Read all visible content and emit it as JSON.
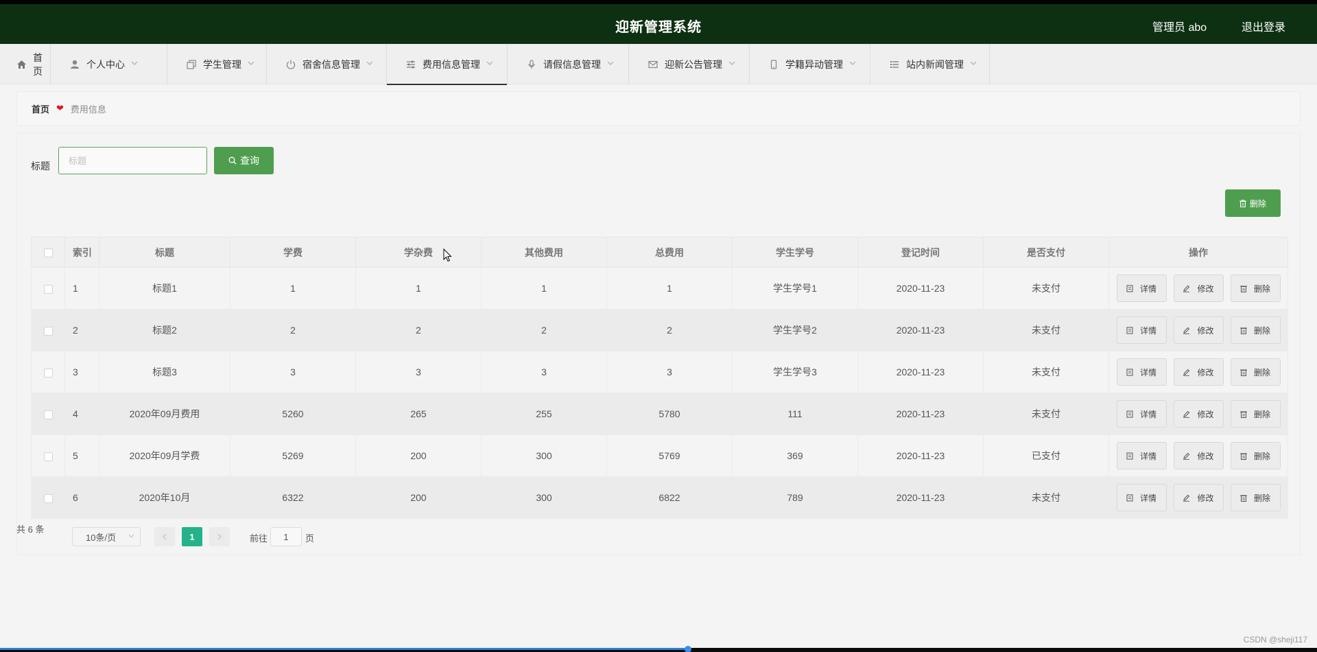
{
  "header": {
    "title": "迎新管理系统",
    "user": "管理员 abo",
    "logout": "退出登录",
    "bg_color": "#0e3012"
  },
  "nav": [
    {
      "label": "首页",
      "icon": "home-icon",
      "has_chevron": false
    },
    {
      "label": "个人中心",
      "icon": "user-icon",
      "has_chevron": true
    },
    {
      "label": "学生管理",
      "icon": "copy-icon",
      "has_chevron": true
    },
    {
      "label": "宿舍信息管理",
      "icon": "power-icon",
      "has_chevron": true
    },
    {
      "label": "费用信息管理",
      "icon": "sliders-icon",
      "has_chevron": true,
      "active": true
    },
    {
      "label": "请假信息管理",
      "icon": "microphone-icon",
      "has_chevron": true
    },
    {
      "label": "迎新公告管理",
      "icon": "mail-icon",
      "has_chevron": true
    },
    {
      "label": "学籍异动管理",
      "icon": "phone-icon",
      "has_chevron": true
    },
    {
      "label": "站内新闻管理",
      "icon": "list-icon",
      "has_chevron": true
    }
  ],
  "breadcrumb": {
    "home": "首页",
    "current": "费用信息"
  },
  "search": {
    "label": "标题",
    "placeholder": "标题",
    "button": "查询"
  },
  "toolbar": {
    "delete_label": "删除"
  },
  "table": {
    "columns": [
      "索引",
      "标题",
      "学费",
      "学杂费",
      "其他费用",
      "总费用",
      "学生学号",
      "登记时间",
      "是否支付",
      "操作"
    ],
    "rows": [
      {
        "index": "1",
        "title": "标题1",
        "tuition": "1",
        "misc": "1",
        "other": "1",
        "total": "1",
        "student_no": "学生学号1",
        "date": "2020-11-23",
        "paid": "未支付"
      },
      {
        "index": "2",
        "title": "标题2",
        "tuition": "2",
        "misc": "2",
        "other": "2",
        "total": "2",
        "student_no": "学生学号2",
        "date": "2020-11-23",
        "paid": "未支付"
      },
      {
        "index": "3",
        "title": "标题3",
        "tuition": "3",
        "misc": "3",
        "other": "3",
        "total": "3",
        "student_no": "学生学号3",
        "date": "2020-11-23",
        "paid": "未支付"
      },
      {
        "index": "4",
        "title": "2020年09月费用",
        "tuition": "5260",
        "misc": "265",
        "other": "255",
        "total": "5780",
        "student_no": "111",
        "date": "2020-11-23",
        "paid": "未支付"
      },
      {
        "index": "5",
        "title": "2020年09月学费",
        "tuition": "5269",
        "misc": "200",
        "other": "300",
        "total": "5769",
        "student_no": "369",
        "date": "2020-11-23",
        "paid": "已支付"
      },
      {
        "index": "6",
        "title": "2020年10月",
        "tuition": "6322",
        "misc": "200",
        "other": "300",
        "total": "6822",
        "student_no": "789",
        "date": "2020-11-23",
        "paid": "未支付"
      }
    ],
    "actions": {
      "detail": "详情",
      "edit": "修改",
      "delete": "删除"
    }
  },
  "pagination": {
    "total": "共 6 条",
    "page_size": "10条/页",
    "current_page": "1",
    "goto_prefix": "前往",
    "goto_value": "1",
    "goto_suffix": "页"
  },
  "watermark": "CSDN @sheji117",
  "colors": {
    "accent_green": "#4f9e4f",
    "page_active": "#23b28a",
    "heart": "#e0121e"
  }
}
